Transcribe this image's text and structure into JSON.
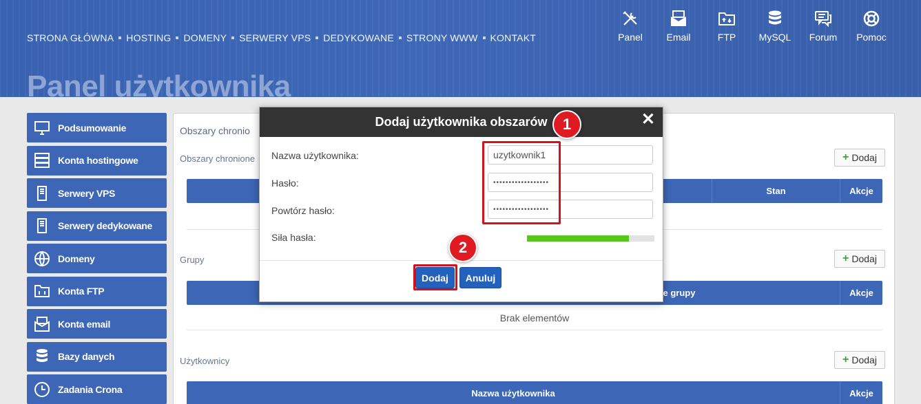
{
  "nav": [
    "STRONA GŁÓWNA",
    "HOSTING",
    "DOMENY",
    "SERWERY VPS",
    "DEDYKOWANE",
    "STRONY WWW",
    "KONTAKT"
  ],
  "top_icons": [
    {
      "label": "Panel",
      "icon": "tools-icon"
    },
    {
      "label": "Email",
      "icon": "email-icon"
    },
    {
      "label": "FTP",
      "icon": "ftp-folder-icon"
    },
    {
      "label": "MySQL",
      "icon": "database-icon"
    },
    {
      "label": "Forum",
      "icon": "forum-icon"
    },
    {
      "label": "Pomoc",
      "icon": "lifebuoy-icon"
    }
  ],
  "page_title": "Panel użytkownika",
  "sidebar": [
    {
      "label": "Podsumowanie",
      "icon": "monitor-icon"
    },
    {
      "label": "Konta hostingowe",
      "icon": "server-icon"
    },
    {
      "label": "Serwery VPS",
      "icon": "vps-icon"
    },
    {
      "label": "Serwery dedykowane",
      "icon": "dedicated-server-icon"
    },
    {
      "label": "Domeny",
      "icon": "globe-icon"
    },
    {
      "label": "Konta FTP",
      "icon": "ftp-icon"
    },
    {
      "label": "Konta email",
      "icon": "mail-icon"
    },
    {
      "label": "Bazy danych",
      "icon": "database-icon"
    },
    {
      "label": "Zadania Crona",
      "icon": "clock-icon"
    }
  ],
  "content": {
    "section_title": "Obszary chronio",
    "protected_areas_label": "Obszary chronione",
    "add_label": "Dodaj",
    "col_stan": "Stan",
    "col_akcje": "Akcje",
    "groups_label": "Grupy",
    "groups_col": "e grupy",
    "empty_text": "Brak elementów",
    "users_label": "Użytkownicy",
    "users_col": "Nazwa użytkownika"
  },
  "modal": {
    "title": "Dodaj użytkownika obszarów",
    "close": "✕",
    "username_label": "Nazwa użytkownika:",
    "username_value": "uzytkownik1",
    "password_label": "Hasło:",
    "password_value": "••••••••••••••••••",
    "repeat_label": "Powtórz hasło:",
    "repeat_value": "••••••••••••••••••",
    "strength_label": "Siła hasła:",
    "strength_fraction": 0.8,
    "submit": "Dodaj",
    "cancel": "Anuluj"
  },
  "annotations": {
    "badge1": "1",
    "badge2": "2",
    "color": "#d5121b"
  }
}
